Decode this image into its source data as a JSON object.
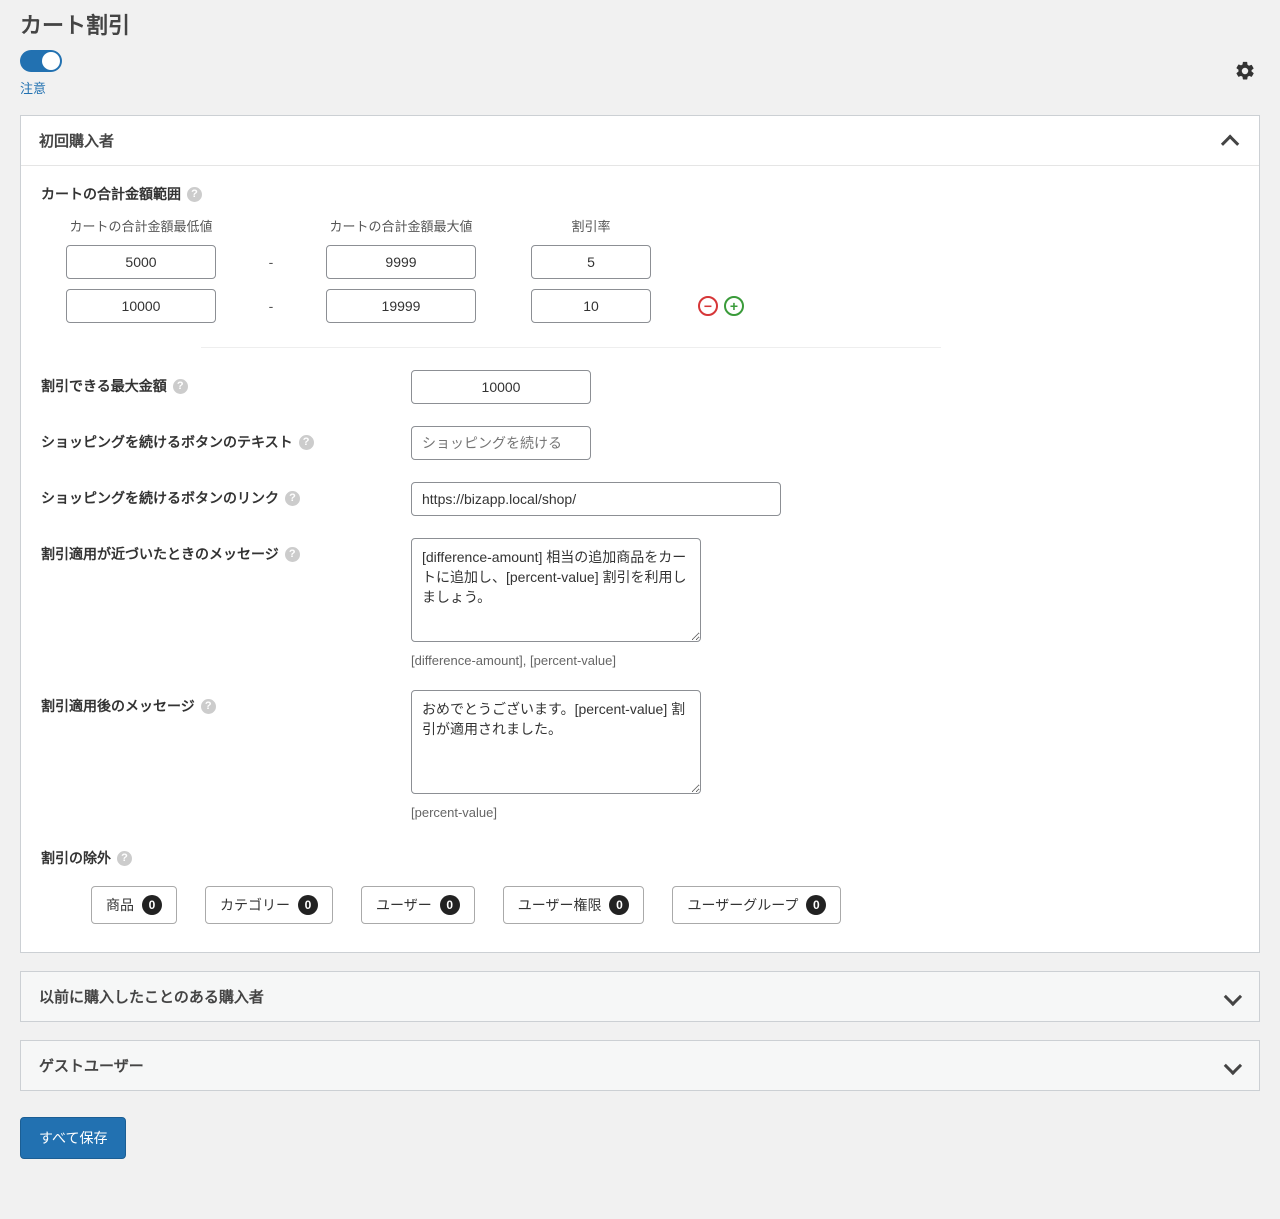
{
  "page": {
    "title": "カート割引",
    "notice": "注意"
  },
  "panel1": {
    "title": "初回購入者",
    "rangeSection": {
      "label": "カートの合計金額範囲",
      "headers": {
        "min": "カートの合計金額最低値",
        "max": "カートの合計金額最大値",
        "rate": "割引率"
      },
      "rows": [
        {
          "min": "5000",
          "max": "9999",
          "rate": "5"
        },
        {
          "min": "10000",
          "max": "19999",
          "rate": "10"
        }
      ]
    },
    "maxDiscount": {
      "label": "割引できる最大金額",
      "value": "10000"
    },
    "continueText": {
      "label": "ショッピングを続けるボタンのテキスト",
      "placeholder": "ショッピングを続ける"
    },
    "continueLink": {
      "label": "ショッピングを続けるボタンのリンク",
      "value": "https://bizapp.local/shop/"
    },
    "nearMsg": {
      "label": "割引適用が近づいたときのメッセージ",
      "value": "[difference-amount] 相当の追加商品をカートに追加し、[percent-value] 割引を利用しましょう。",
      "hint": "[difference-amount], [percent-value]"
    },
    "appliedMsg": {
      "label": "割引適用後のメッセージ",
      "value": "おめでとうございます。[percent-value] 割引が適用されました。",
      "hint": "[percent-value]"
    },
    "exclude": {
      "label": "割引の除外",
      "items": [
        {
          "label": "商品",
          "count": "0"
        },
        {
          "label": "カテゴリー",
          "count": "0"
        },
        {
          "label": "ユーザー",
          "count": "0"
        },
        {
          "label": "ユーザー権限",
          "count": "0"
        },
        {
          "label": "ユーザーグループ",
          "count": "0"
        }
      ]
    }
  },
  "panel2": {
    "title": "以前に購入したことのある購入者"
  },
  "panel3": {
    "title": "ゲストユーザー"
  },
  "saveLabel": "すべて保存"
}
